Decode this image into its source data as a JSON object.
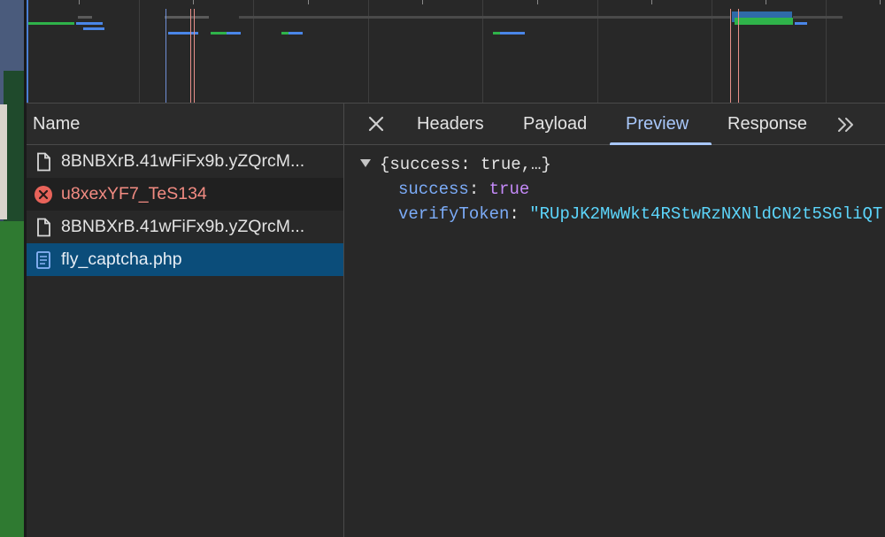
{
  "network_list": {
    "column_header": "Name",
    "requests": [
      {
        "name": "8BNBXrB.41wFiFx9b.yZQrcM...",
        "icon": "document-icon",
        "status": "normal"
      },
      {
        "name": "u8xexYF7_TeS134",
        "icon": "error-icon",
        "status": "error"
      },
      {
        "name": "8BNBXrB.41wFiFx9b.yZQrcM...",
        "icon": "document-icon",
        "status": "normal"
      },
      {
        "name": "fly_captcha.php",
        "icon": "script-document-icon",
        "status": "selected"
      }
    ]
  },
  "detail_tabs": {
    "close_icon": "close-icon",
    "tabs": [
      {
        "label": "Headers",
        "active": false
      },
      {
        "label": "Payload",
        "active": false
      },
      {
        "label": "Preview",
        "active": true
      },
      {
        "label": "Response",
        "active": false
      }
    ],
    "more_icon": "double-chevron-right-icon"
  },
  "preview": {
    "summary": "{success: true,…}",
    "fields": [
      {
        "key": "success",
        "separator": ": ",
        "value": "true",
        "type": "boolean"
      },
      {
        "key": "verifyToken",
        "separator": ": ",
        "value": "\"RUpJK2MwWkt4RStwRzNXNldCN2t5SGliQT",
        "type": "string"
      }
    ]
  },
  "colors": {
    "selected_row": "#0b4d7a",
    "active_tab": "#a8c7fa",
    "error_text": "#f28b82",
    "json_key": "#7cacf8",
    "json_boolean": "#c58af9",
    "json_string": "#5cd5fb"
  }
}
